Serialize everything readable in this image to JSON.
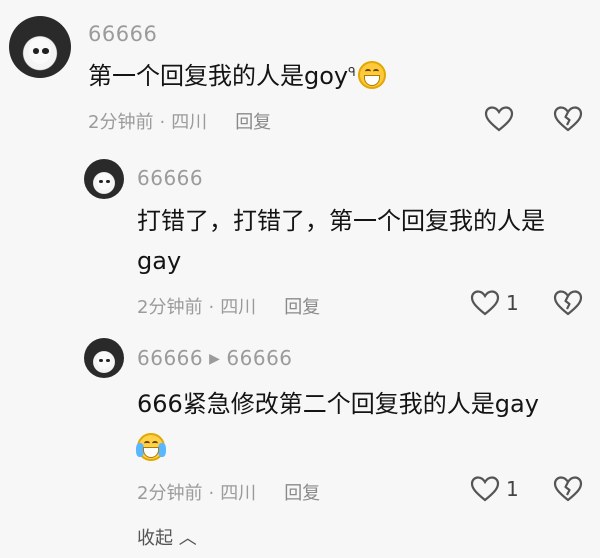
{
  "comments": [
    {
      "username": "66666",
      "text": "第一个回复我的人是goy",
      "search_mark": "ᑫ",
      "time": "2分钟前",
      "location": "四川",
      "reply_label": "回复",
      "likes": ""
    },
    {
      "username": "66666",
      "text_line1": "打错了，打错了，第一个回复我的人是",
      "text_line2": "gay",
      "time": "2分钟前",
      "location": "四川",
      "reply_label": "回复",
      "likes": "1"
    },
    {
      "username": "66666",
      "reply_to": "66666",
      "text": "666紧急修改第二个回复我的人是gay",
      "time": "2分钟前",
      "location": "四川",
      "reply_label": "回复",
      "likes": "1"
    }
  ],
  "separator": "·",
  "collapse_label": "收起 ︿",
  "colors": {
    "meta": "#9b9b9b",
    "text": "#141414",
    "background": "#f7f7f7"
  },
  "icons": [
    "heart-outline-icon",
    "broken-heart-icon",
    "grin-emoji-icon",
    "laugh-cry-emoji-icon",
    "chevron-up-icon"
  ]
}
